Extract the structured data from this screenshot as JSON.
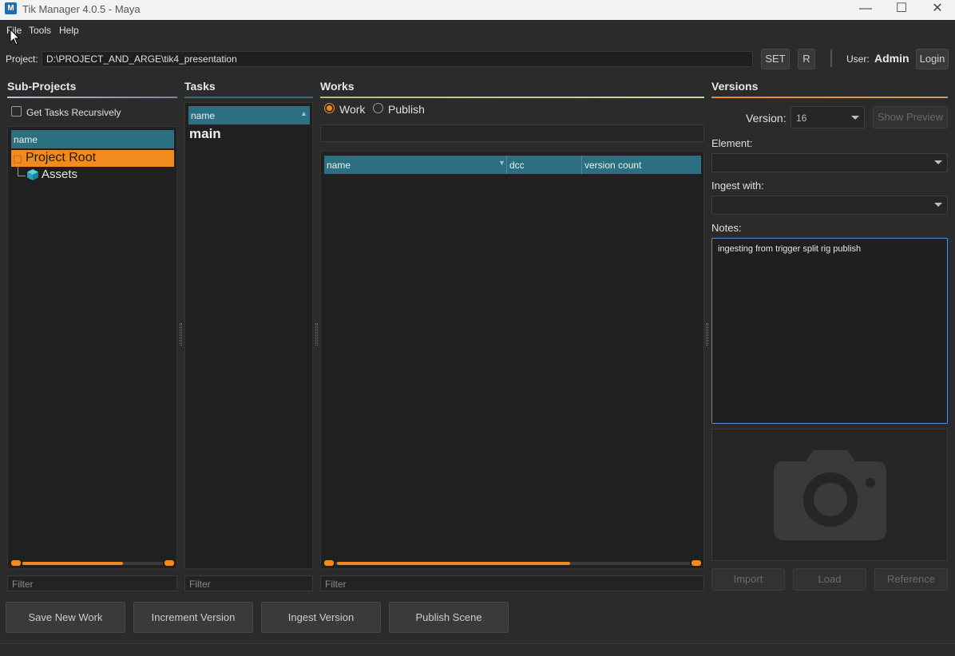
{
  "window": {
    "title": "Tik Manager 4.0.5 - Maya",
    "app_icon": "M",
    "minimize": "—",
    "maximize": "☐",
    "close": "✕"
  },
  "menu": [
    "File",
    "Tools",
    "Help"
  ],
  "project": {
    "label": "Project:",
    "path": "D:\\PROJECT_AND_ARGE\\tik4_presentation",
    "set_button": "SET",
    "r_button": "R",
    "user_label": "User:",
    "user_name": "Admin",
    "login_button": "Login"
  },
  "subprojects": {
    "title": "Sub-Projects",
    "recursive_label": "Get Tasks Recursively",
    "column": "name",
    "tree": [
      {
        "label": "Project Root",
        "icon": "folder-icon",
        "selected": true
      },
      {
        "label": "Assets",
        "icon": "cube-icon",
        "selected": false
      }
    ],
    "filter_placeholder": "Filter"
  },
  "tasks": {
    "title": "Tasks",
    "column": "name",
    "items": [
      "main"
    ],
    "filter_placeholder": "Filter"
  },
  "works": {
    "title": "Works",
    "mode_work": "Work",
    "mode_publish": "Publish",
    "selected_mode": "Work",
    "columns": [
      "name",
      "dcc",
      "version count"
    ],
    "filter_placeholder": "Filter"
  },
  "versions": {
    "title": "Versions",
    "version_label": "Version:",
    "version_value": "16",
    "show_preview": "Show Preview",
    "element_label": "Element:",
    "element_value": "",
    "ingest_label": "Ingest with:",
    "ingest_value": "",
    "notes_label": "Notes:",
    "notes": "ingesting from trigger split rig publish",
    "preview_icon": "camera-icon",
    "import": "Import",
    "load": "Load",
    "reference": "Reference"
  },
  "actions": {
    "save_new_work": "Save New Work",
    "increment_version": "Increment Version",
    "ingest_version": "Ingest Version",
    "publish_scene": "Publish Scene"
  },
  "colors": {
    "accent": "#f28a20",
    "header": "#2b6f80",
    "focus": "#4f8fd6"
  }
}
